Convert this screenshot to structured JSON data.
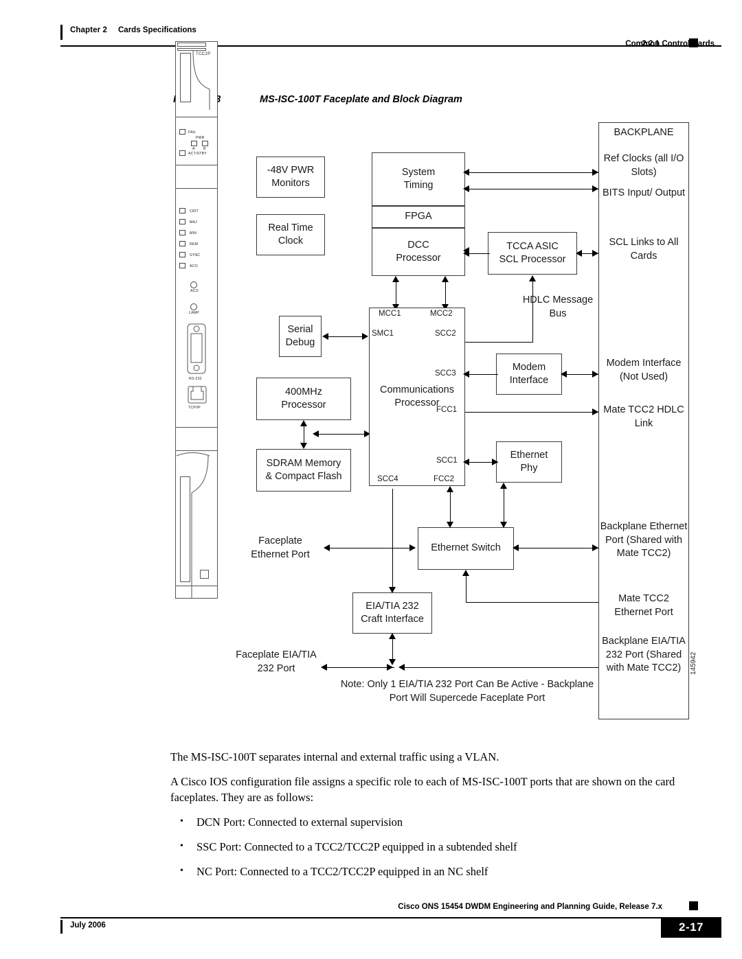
{
  "header": {
    "chapter": "Chapter 2",
    "chapter_title": "Cards Specifications",
    "section_number": "2.2.1",
    "section_title": "Common Control Cards"
  },
  "figure": {
    "caption": "Figure 2-3",
    "title": "MS-ISC-100T Faceplate and Block Diagram",
    "figure_id": "145942"
  },
  "faceplate": {
    "card_name": "TCC2P",
    "status_leds": [
      "FAIL",
      "ACT/STBY"
    ],
    "pwr_label": "PWR",
    "pwr_a": "A",
    "pwr_b": "B",
    "alarm_leds": [
      "CRIT",
      "MAJ",
      "MIN",
      "REM",
      "SYNC",
      "ACO"
    ],
    "buttons": [
      "ACO",
      "LAMP"
    ],
    "connectors": [
      "RS-232",
      "TCP/IP"
    ]
  },
  "diagram": {
    "boxes": {
      "pwr_monitors": {
        "line1": "-48V PWR",
        "line2": "Monitors"
      },
      "real_time_clock": {
        "line1": "Real Time",
        "line2": "Clock"
      },
      "serial_debug": {
        "line1": "Serial",
        "line2": "Debug"
      },
      "processor_400mhz": {
        "line1": "400MHz",
        "line2": "Processor"
      },
      "sdram": {
        "line1": "SDRAM Memory",
        "line2": "& Compact Flash"
      },
      "system_timing": {
        "line1": "System",
        "line2": "Timing"
      },
      "fpga": {
        "line1": "FPGA"
      },
      "dcc_processor": {
        "line1": "DCC",
        "line2": "Processor"
      },
      "comm_processor": {
        "line1": "Communications",
        "line2": "Processor"
      },
      "tcca_asic": {
        "line1": "TCCA ASIC",
        "line2": "SCL Processor"
      },
      "modem_interface": {
        "line1": "Modem",
        "line2": "Interface"
      },
      "ethernet_phy": {
        "line1": "Ethernet",
        "line2": "Phy"
      },
      "ethernet_switch": {
        "line1": "Ethernet Switch"
      },
      "eia_craft": {
        "line1": "EIA/TIA 232",
        "line2": "Craft Interface"
      }
    },
    "comm_ports": {
      "mcc1": "MCC1",
      "mcc2": "MCC2",
      "smc1": "SMC1",
      "scc2": "SCC2",
      "scc3": "SCC3",
      "fcc1": "FCC1",
      "scc1": "SCC1",
      "scc4": "SCC4",
      "fcc2": "FCC2"
    },
    "labels": {
      "hdlc_message_bus": {
        "line1": "HDLC",
        "line2": "Message",
        "line3": "Bus"
      },
      "faceplate_ethernet_port": {
        "line1": "Faceplate",
        "line2": "Ethernet Port"
      },
      "faceplate_eia_port": {
        "line1": "Faceplate",
        "line2": "EIA/TIA 232 Port"
      },
      "note": {
        "line1": "Note:  Only 1 EIA/TIA 232 Port Can Be Active -",
        "line2": "Backplane Port Will Supercede Faceplate Port"
      }
    },
    "backplane": {
      "title": "BACKPLANE",
      "items": [
        {
          "line1": "Ref Clocks",
          "line2": "(all I/O Slots)"
        },
        {
          "line1": "BITS Input/",
          "line2": "Output"
        },
        {
          "line1": "SCL Links to",
          "line2": "All Cards"
        },
        {
          "line1": "Modem",
          "line2": "Interface",
          "line3": "(Not Used)"
        },
        {
          "line1": "Mate TCC2",
          "line2": "HDLC Link"
        },
        {
          "line1": "Backplane",
          "line2": "Ethernet Port",
          "line3": "(Shared with",
          "line4": "Mate TCC2)"
        },
        {
          "line1": "Mate TCC2",
          "line2": "Ethernet Port"
        },
        {
          "line1": "Backplane",
          "line2": "EIA/TIA 232 Port",
          "line3": "(Shared with",
          "line4": "Mate TCC2)"
        }
      ]
    }
  },
  "body": {
    "para1": "The MS-ISC-100T separates internal and external traffic using a VLAN.",
    "para2": "A Cisco IOS configuration file assigns a specific role to each of MS-ISC-100T ports that are shown on the card faceplates. They are as follows:",
    "bullet_char": "•",
    "bullets": [
      "DCN Port: Connected to external supervision",
      "SSC Port: Connected to a TCC2/TCC2P equipped in a subtended shelf",
      "NC Port: Connected to a TCC2/TCC2P equipped in an NC shelf"
    ]
  },
  "footer": {
    "guide_title": "Cisco ONS 15454 DWDM Engineering and Planning Guide, Release 7.x",
    "date": "July 2006",
    "page_number": "2-17"
  }
}
